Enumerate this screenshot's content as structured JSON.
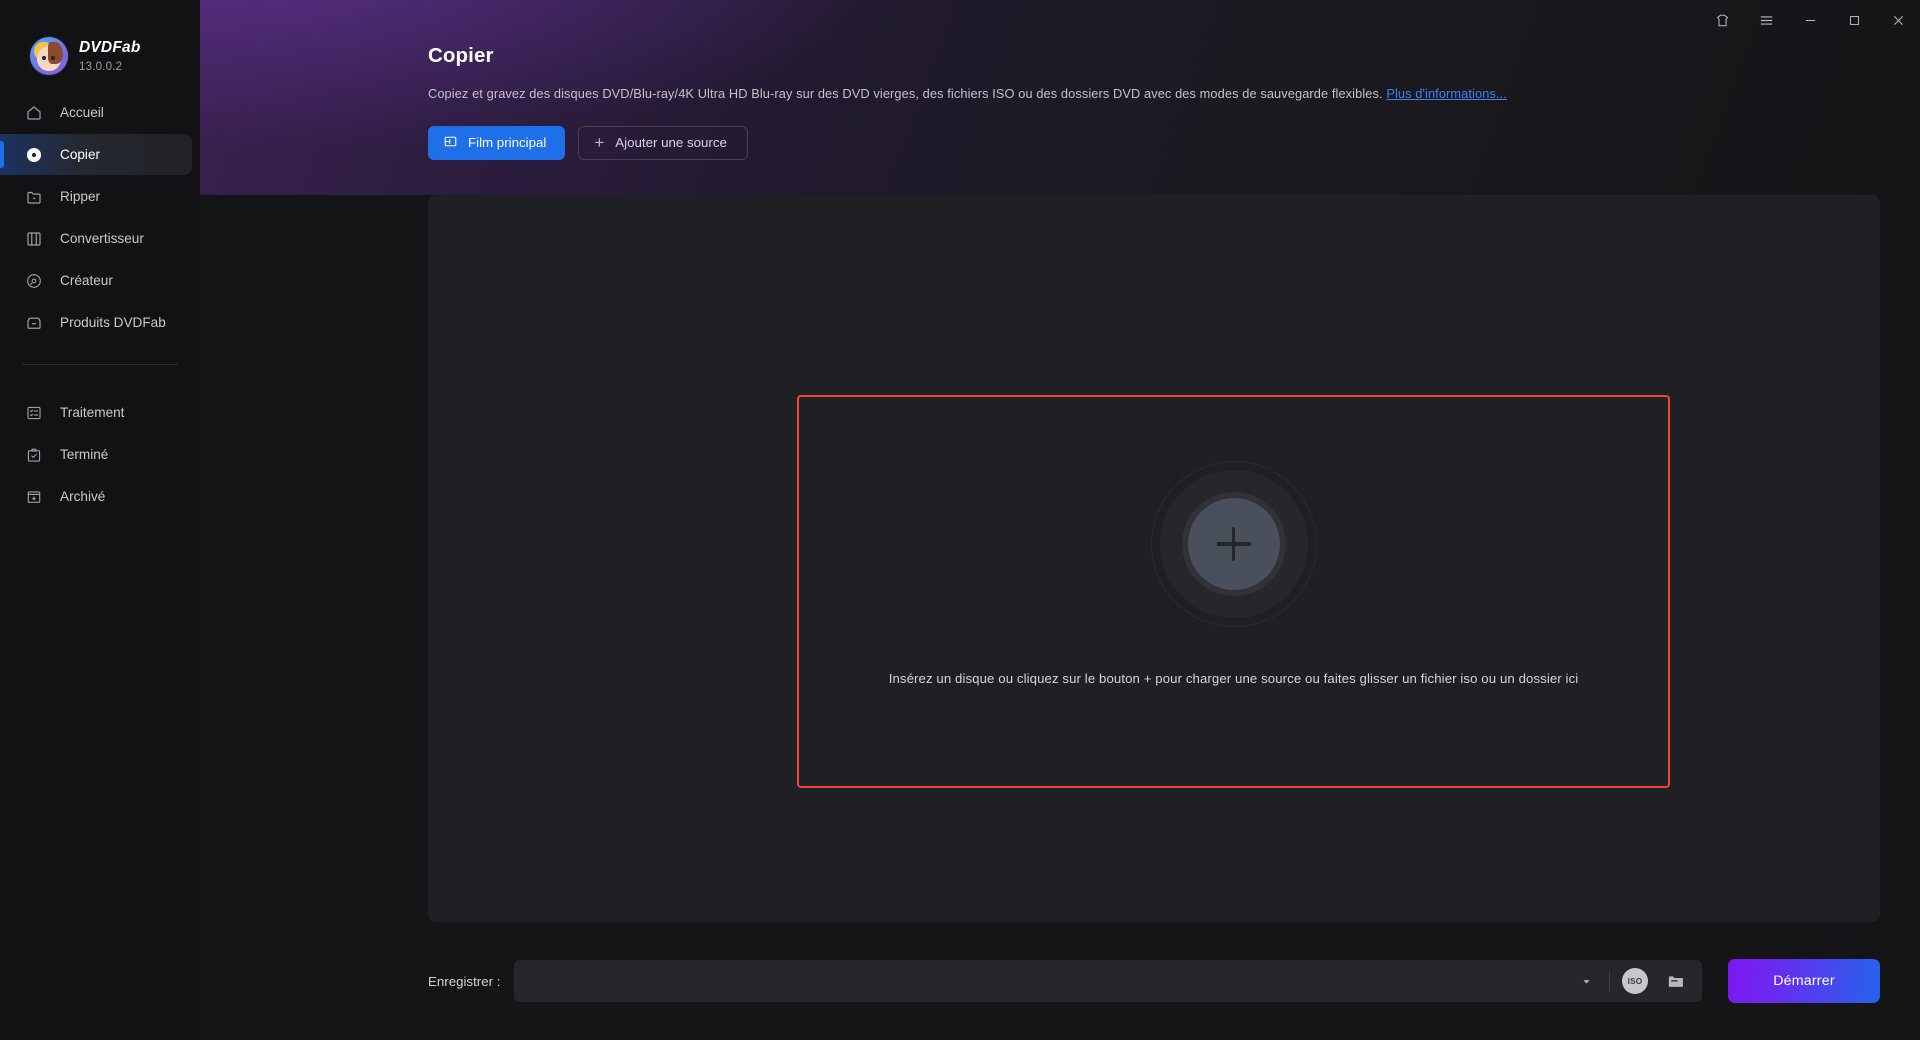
{
  "app": {
    "brand_name": "DVDFab",
    "version": "13.0.0.2"
  },
  "titlebar": {
    "theme_icon": "shirt-icon",
    "menu_icon": "hamburger-menu-icon",
    "minimize_icon": "minimize-icon",
    "maximize_icon": "maximize-icon",
    "close_icon": "close-icon"
  },
  "sidebar": {
    "items": [
      {
        "label": "Accueil",
        "icon": "home-icon",
        "active": false
      },
      {
        "label": "Copier",
        "icon": "disc-icon",
        "active": true
      },
      {
        "label": "Ripper",
        "icon": "rip-icon",
        "active": false
      },
      {
        "label": "Convertisseur",
        "icon": "film-icon",
        "active": false
      },
      {
        "label": "Créateur",
        "icon": "creator-icon",
        "active": false
      },
      {
        "label": "Produits DVDFab",
        "icon": "products-icon",
        "active": false
      }
    ],
    "items_secondary": [
      {
        "label": "Traitement",
        "icon": "tasklist-icon",
        "active": false
      },
      {
        "label": "Terminé",
        "icon": "clipboard-check-icon",
        "active": false
      },
      {
        "label": "Archivé",
        "icon": "archive-icon",
        "active": false
      }
    ]
  },
  "page": {
    "title": "Copier",
    "description": "Copiez et gravez des disques DVD/Blu-ray/4K Ultra HD Blu-ray sur des DVD vierges, des fichiers ISO ou des dossiers DVD avec des modes de sauvegarde flexibles.",
    "more_link": "Plus d'informations...",
    "mode_button": "Film principal",
    "add_source_button": "Ajouter une source"
  },
  "dropzone": {
    "hint": "Insérez un disque ou cliquez sur le bouton +  pour charger une source ou faites glisser un fichier iso ou un dossier ici",
    "plus_icon": "plus-icon",
    "border_color": "#f04438"
  },
  "bottom": {
    "save_label": "Enregistrer :",
    "save_value": "",
    "save_placeholder": "",
    "dropdown_icon": "chevron-down-icon",
    "iso_icon_label": "ISO",
    "folder_icon": "folder-icon",
    "start_button": "Démarrer"
  },
  "colors": {
    "accent_blue": "#1f6fe8",
    "start_gradient_from": "#7d18f0",
    "start_gradient_to": "#2563eb",
    "dropzone_red": "#f04438",
    "link_blue": "#3b82f6"
  }
}
